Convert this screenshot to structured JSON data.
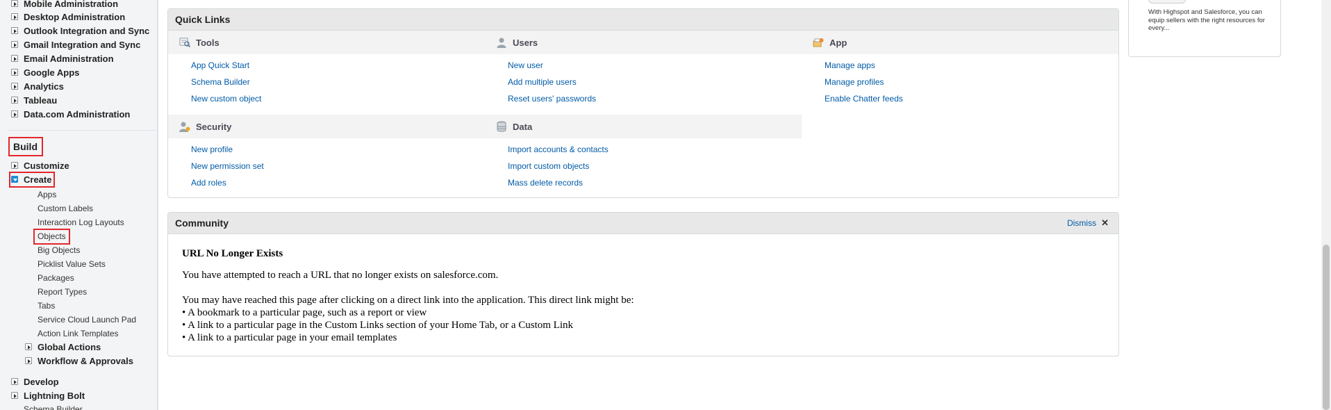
{
  "sidebar": {
    "admin_items": [
      {
        "label": "Mobile Administration"
      },
      {
        "label": "Desktop Administration"
      },
      {
        "label": "Outlook Integration and Sync"
      },
      {
        "label": "Gmail Integration and Sync"
      },
      {
        "label": "Email Administration"
      },
      {
        "label": "Google Apps"
      },
      {
        "label": "Analytics"
      },
      {
        "label": "Tableau"
      },
      {
        "label": "Data.com Administration"
      }
    ],
    "build_label": "Build",
    "customize_label": "Customize",
    "create_label": "Create",
    "create_children": [
      {
        "label": "Apps"
      },
      {
        "label": "Custom Labels"
      },
      {
        "label": "Interaction Log Layouts"
      },
      {
        "label": "Objects"
      },
      {
        "label": "Big Objects"
      },
      {
        "label": "Picklist Value Sets"
      },
      {
        "label": "Packages"
      },
      {
        "label": "Report Types"
      },
      {
        "label": "Tabs"
      },
      {
        "label": "Service Cloud Launch Pad"
      },
      {
        "label": "Action Link Templates"
      }
    ],
    "global_actions_label": "Global Actions",
    "workflow_label": "Workflow & Approvals",
    "develop_label": "Develop",
    "lightning_bolt_label": "Lightning Bolt",
    "schema_builder_label": "Schema Builder"
  },
  "quick_links": {
    "title": "Quick Links",
    "tools": {
      "heading": "Tools",
      "links": [
        "App Quick Start",
        "Schema Builder",
        "New custom object"
      ]
    },
    "users": {
      "heading": "Users",
      "links": [
        "New user",
        "Add multiple users",
        "Reset users' passwords"
      ]
    },
    "app": {
      "heading": "App",
      "links": [
        "Manage apps",
        "Manage profiles",
        "Enable Chatter feeds"
      ]
    },
    "security": {
      "heading": "Security",
      "links": [
        "New profile",
        "New permission set",
        "Add roles"
      ]
    },
    "data": {
      "heading": "Data",
      "links": [
        "Import accounts & contacts",
        "Import custom objects",
        "Mass delete records"
      ]
    }
  },
  "community": {
    "title": "Community",
    "dismiss_label": "Dismiss",
    "dismiss_glyph": "✕"
  },
  "error": {
    "title": "URL No Longer Exists",
    "message": "You have attempted to reach a URL that no longer exists on salesforce.com.",
    "intro": "You may have reached this page after clicking on a direct link into the application. This direct link might be:",
    "bullets": [
      "• A bookmark to a particular page, such as a report or view",
      "• A link to a particular page in the Custom Links section of your Home Tab, or a Custom Link",
      "• A link to a particular page in your email templates"
    ]
  },
  "right_card": {
    "text": "With Highspot and Salesforce, you can equip sellers with the right resources for every..."
  },
  "colors": {
    "link": "#015ba7",
    "highlight": "#e3262c",
    "expanded_twisty": "#1f8dd6"
  }
}
